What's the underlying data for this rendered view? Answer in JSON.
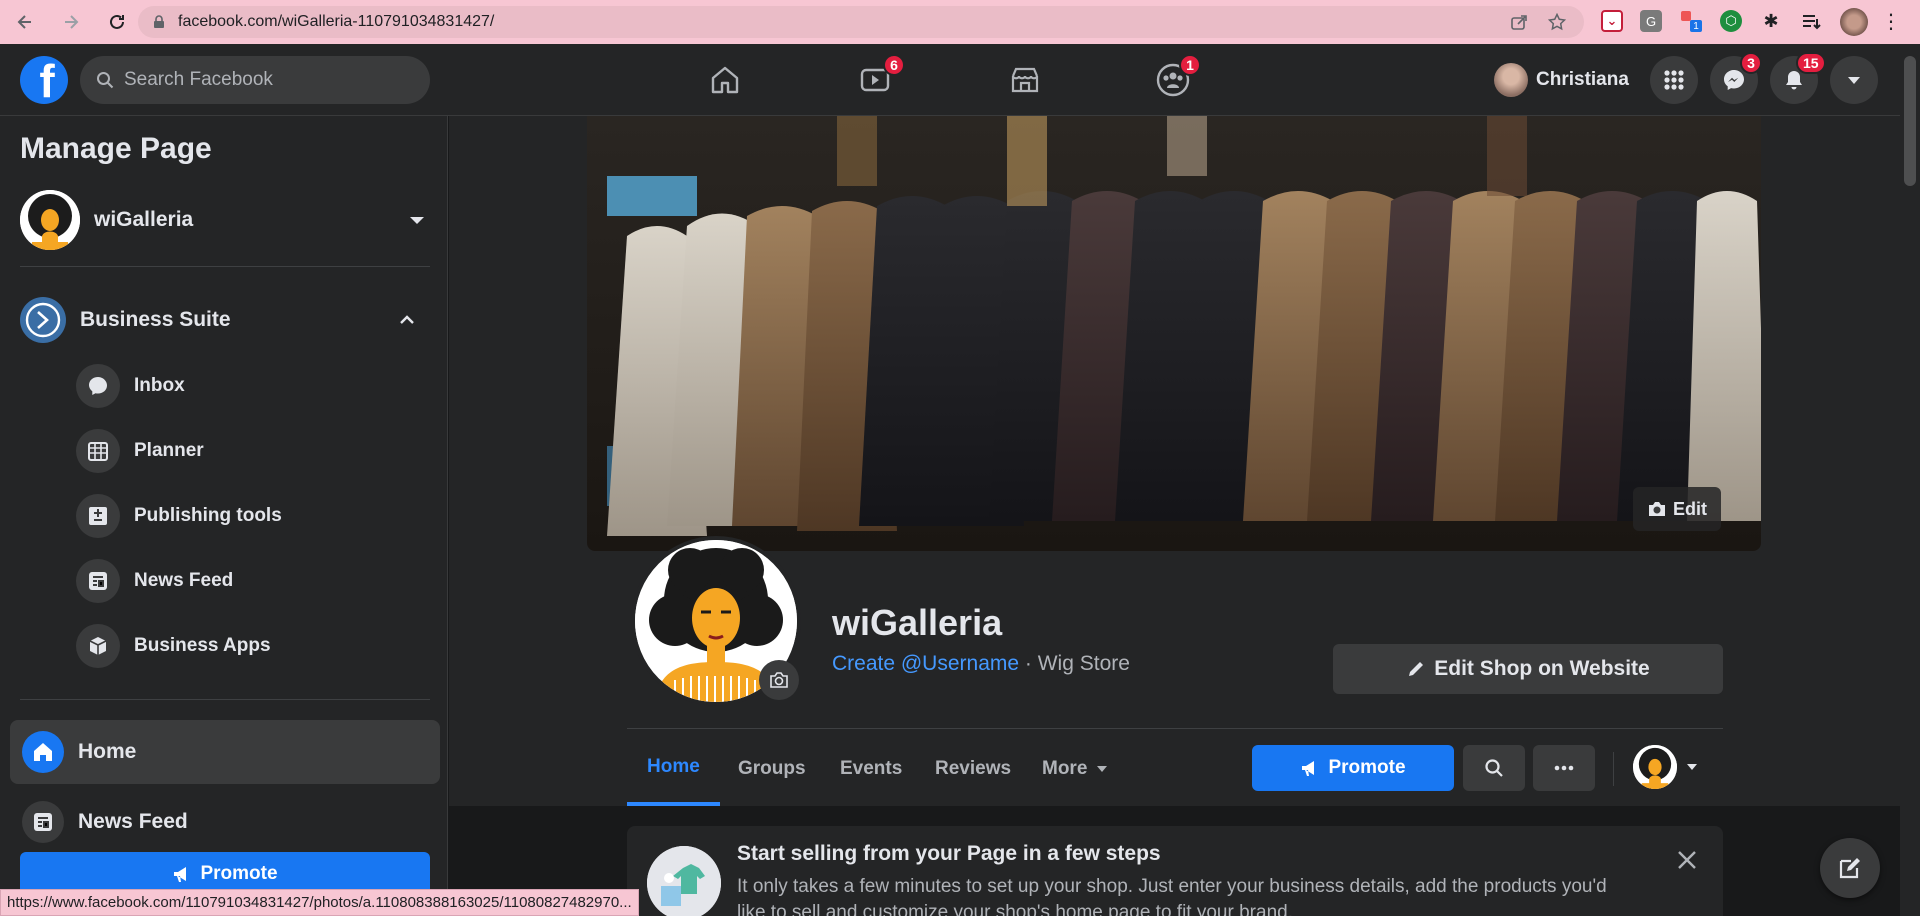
{
  "browser": {
    "url": "facebook.com/wiGalleria-110791034831427/",
    "ext_badge": "1",
    "status_url": "https://www.facebook.com/110791034831427/photos/a.110808388163025/11080827482970..."
  },
  "topnav": {
    "search_placeholder": "Search Facebook",
    "watch_badge": "6",
    "groups_badge": "1",
    "user_name": "Christiana",
    "messenger_badge": "3",
    "notifications_badge": "15"
  },
  "sidebar": {
    "title": "Manage Page",
    "page_name": "wiGalleria",
    "suite_label": "Business Suite",
    "items": [
      {
        "label": "Inbox",
        "icon": "chat-bubble-icon"
      },
      {
        "label": "Planner",
        "icon": "calendar-grid-icon"
      },
      {
        "label": "Publishing tools",
        "icon": "publishing-tools-icon"
      },
      {
        "label": "News Feed",
        "icon": "news-feed-icon"
      },
      {
        "label": "Business Apps",
        "icon": "cube-icon"
      }
    ],
    "home_label": "Home",
    "newsfeed_label": "News Feed",
    "promote_label": "Promote"
  },
  "page": {
    "cover_edit_label": "Edit",
    "name": "wiGalleria",
    "username_link": "Create @Username",
    "category": " · Wig Store",
    "edit_shop_label": "Edit Shop on Website",
    "tabs": [
      "Home",
      "Groups",
      "Events",
      "Reviews",
      "More"
    ],
    "promote_label": "Promote"
  },
  "sell_card": {
    "title": "Start selling from your Page in a few steps",
    "description": "It only takes a few minutes to set up your shop. Just enter your business details, add the products you'd like to sell and customize your shop's home page to fit your brand."
  },
  "colors": {
    "accent": "#1877f2",
    "link": "#4599ff",
    "badge": "#e41e3f",
    "background": "#18191a",
    "card": "#242526"
  }
}
